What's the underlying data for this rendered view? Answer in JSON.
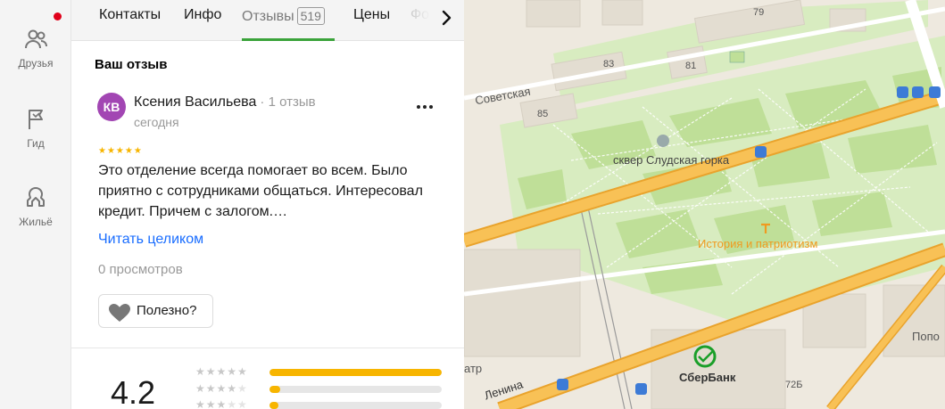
{
  "rail": {
    "items": [
      {
        "label": "Друзья",
        "icon": "friends-icon"
      },
      {
        "label": "Гид",
        "icon": "flag-icon"
      },
      {
        "label": "Жильё",
        "icon": "house-icon"
      }
    ],
    "has_notification": true
  },
  "tabs": {
    "items": [
      {
        "label": "Контакты"
      },
      {
        "label": "Инфо"
      },
      {
        "label": "Отзывы",
        "badge": "519",
        "active": true
      },
      {
        "label": "Цены"
      },
      {
        "label": "Фо"
      }
    ]
  },
  "review_section": {
    "title": "Ваш отзыв",
    "review": {
      "avatar_initials": "КВ",
      "avatar_color": "#a246b3",
      "author": "Ксения Васильева",
      "author_meta": "· 1 отзыв",
      "date": "сегодня",
      "stars": 5,
      "text": "Это отделение всегда помогает во всем. Было приятно с сотрудниками общаться. Интересовал кредит. Причем с залогом.…",
      "read_more": "Читать целиком",
      "views": "0 просмотров",
      "useful_label": "Полезно?"
    }
  },
  "rating": {
    "value": "4.2",
    "distribution": [
      {
        "stars": 5,
        "fraction": 1.0
      },
      {
        "stars": 4,
        "fraction": 0.06
      },
      {
        "stars": 3,
        "fraction": 0.05
      }
    ]
  },
  "map": {
    "labels": {
      "street_sovetskaya": "Советская",
      "street_lenina": "Ленина",
      "park": "сквер Слудская горка",
      "monument": "История и патриотизм",
      "bank": "СберБанк",
      "bldg_79": "79",
      "bldg_83": "83",
      "bldg_81": "81",
      "bldg_85": "85",
      "bldg_72b": "72Б",
      "partial_atr": "атр",
      "partial_popo": "Попо"
    },
    "colors": {
      "road": "#f7b84a",
      "park": "#cfe8b0",
      "block": "#eee9df",
      "monument": "#f09a1f",
      "bank": "#1a9f29"
    }
  }
}
